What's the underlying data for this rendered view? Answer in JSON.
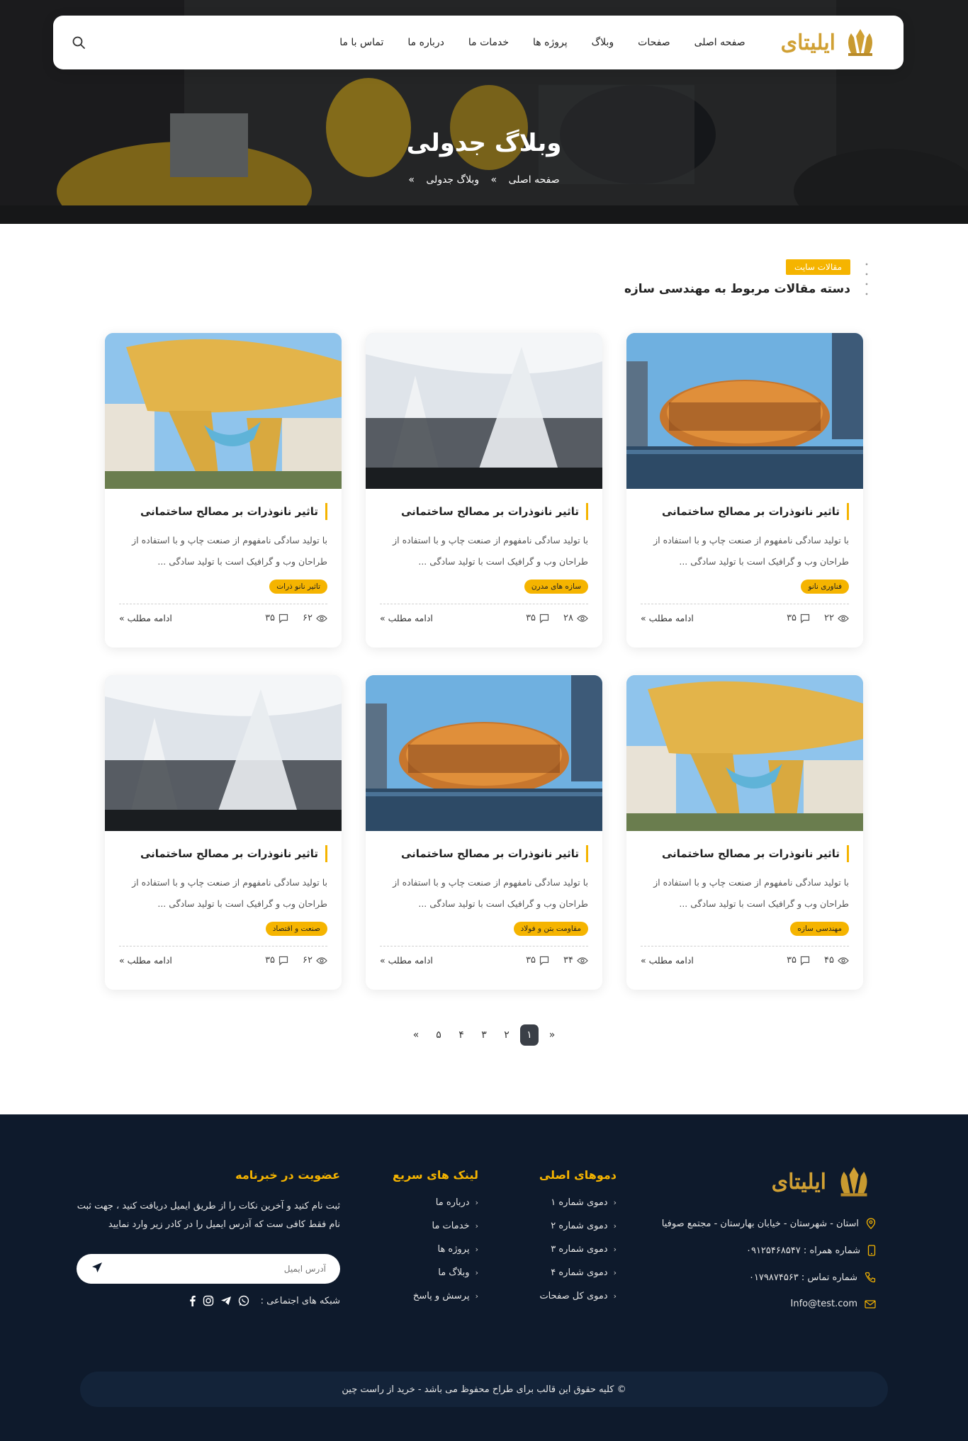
{
  "brand": {
    "logo_text": "ایلیتای",
    "accent_color": "#f5b400",
    "footer_bg": "#0e1a2c"
  },
  "nav": {
    "items": [
      "صفحه اصلی",
      "صفحات",
      "وبلاگ",
      "پروژه ها",
      "خدمات ما",
      "درباره ما",
      "تماس با ما"
    ],
    "search_icon": "search-icon"
  },
  "hero": {
    "title": "وبلاگ جدولی",
    "breadcrumb": {
      "home": "صفحه اصلی",
      "sep": "»",
      "current": "وبلاگ جدولی"
    }
  },
  "section": {
    "badge": "مقالات سایت",
    "title": "دسته مقالات مربوط به مهندسی سازه"
  },
  "cards": [
    {
      "title": "تاثیر نانوذرات بر مصالح ساختمانی",
      "excerpt": "با تولید سادگی نامفهوم از صنعت چاپ و با استفاده از طراحان وب و گرافیک است با تولید سادگی ...",
      "tag": "فناوری نانو",
      "views": "۲۲",
      "comments": "۳۵",
      "read_more": "ادامه مطلب »",
      "image": "building-orange"
    },
    {
      "title": "تاثیر نانوذرات بر مصالح ساختمانی",
      "excerpt": "با تولید سادگی نامفهوم از صنعت چاپ و با استفاده از طراحان وب و گرافیک است با تولید سادگی ...",
      "tag": "سازه های مدرن",
      "views": "۲۸",
      "comments": "۳۵",
      "read_more": "ادامه مطلب »",
      "image": "building-white"
    },
    {
      "title": "تاثیر نانوذرات بر مصالح ساختمانی",
      "excerpt": "با تولید سادگی نامفهوم از صنعت چاپ و با استفاده از طراحان وب و گرافیک است با تولید سادگی ...",
      "tag": "تاثیر نانو ذرات",
      "views": "۶۲",
      "comments": "۳۵",
      "read_more": "ادامه مطلب »",
      "image": "building-golden"
    },
    {
      "title": "تاثیر نانوذرات بر مصالح ساختمانی",
      "excerpt": "با تولید سادگی نامفهوم از صنعت چاپ و با استفاده از طراحان وب و گرافیک است با تولید سادگی ...",
      "tag": "مهندسی سازه",
      "views": "۴۵",
      "comments": "۳۵",
      "read_more": "ادامه مطلب »",
      "image": "building-golden"
    },
    {
      "title": "تاثیر نانوذرات بر مصالح ساختمانی",
      "excerpt": "با تولید سادگی نامفهوم از صنعت چاپ و با استفاده از طراحان وب و گرافیک است با تولید سادگی ...",
      "tag": "مقاومت بتن و فولاد",
      "views": "۳۴",
      "comments": "۳۵",
      "read_more": "ادامه مطلب »",
      "image": "building-orange"
    },
    {
      "title": "تاثیر نانوذرات بر مصالح ساختمانی",
      "excerpt": "با تولید سادگی نامفهوم از صنعت چاپ و با استفاده از طراحان وب و گرافیک است با تولید سادگی ...",
      "tag": "صنعت و اقتصاد",
      "views": "۶۲",
      "comments": "۳۵",
      "read_more": "ادامه مطلب »",
      "image": "building-white"
    }
  ],
  "pagination": {
    "prev": "«",
    "pages": [
      "۱",
      "۲",
      "۳",
      "۴",
      "۵"
    ],
    "next": "»",
    "current": "۱"
  },
  "footer": {
    "logo_text": "ایلیتای",
    "address": "استان - شهرستان - خیابان بهارستان - مجتمع صوفیا",
    "mobile": "شماره همراه : ۰۹۱۲۵۴۶۸۵۴۷",
    "phone": "شماره تماس : ۰۱۷۹۸۷۴۵۶۳",
    "email": "Info@test.com",
    "demos": {
      "title": "دموهای اصلی",
      "items": [
        "دموی شماره ۱",
        "دموی شماره ۲",
        "دموی شماره ۳",
        "دموی شماره ۴",
        "دموی کل صفحات"
      ]
    },
    "quick": {
      "title": "لینک های سریع",
      "items": [
        "درباره ما",
        "خدمات ما",
        "پروژه ها",
        "وبلاگ ما",
        "پرسش و پاسخ"
      ]
    },
    "newsletter": {
      "title": "عضویت در خبرنامه",
      "text": "ثبت نام کنید و آخرین نکات را از طریق ایمیل دریافت کنید ، جهت ثبت نام فقط کافی ست که آدرس ایمیل را در کادر زیر وارد نمایید",
      "placeholder": "آدرس ایمیل",
      "social_label": "شبکه های اجتماعی :"
    },
    "copyright": "© کلیه حقوق این قالب برای طراح محفوظ می باشد -  خرید از راست چین"
  }
}
